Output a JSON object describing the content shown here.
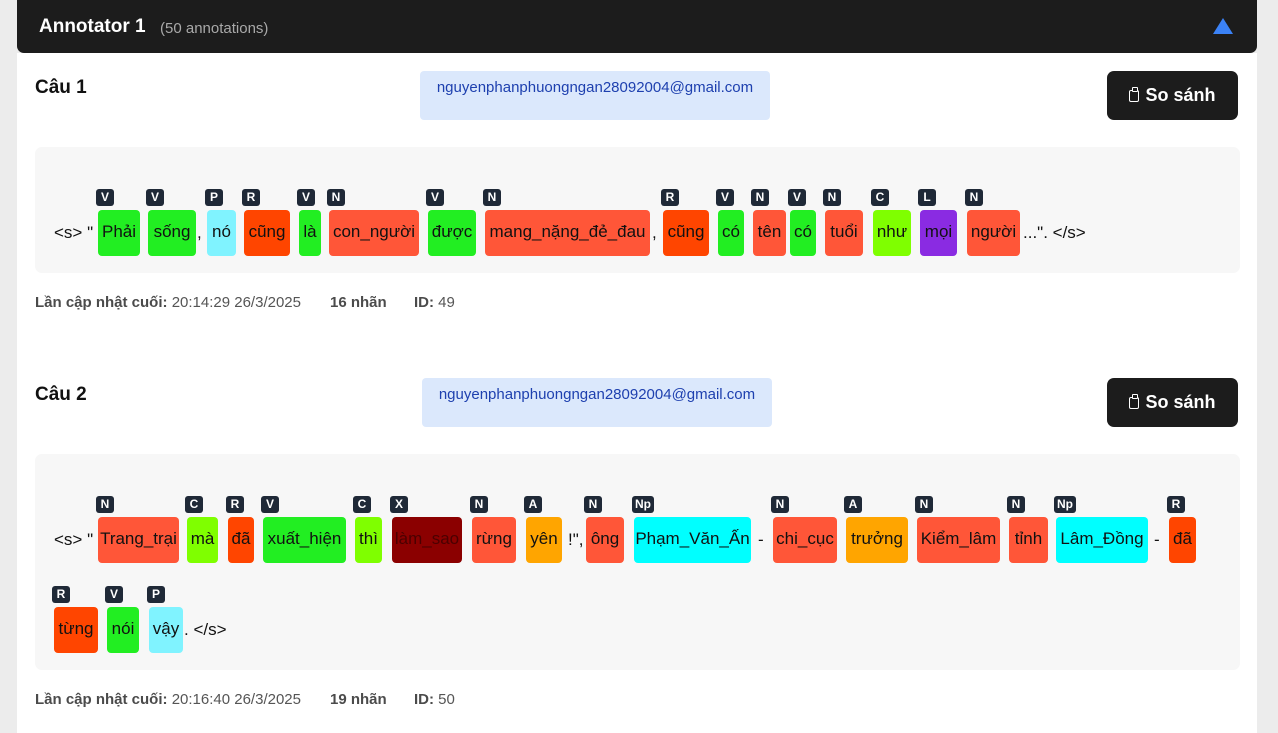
{
  "annotator": {
    "title": "Annotator 1",
    "count_text": "(50 annotations)",
    "collapse_icon": "triangle-up-icon"
  },
  "sentences": [
    {
      "title": "Câu 1",
      "email": "nguyenphanphuongngan28092004@gmail.com",
      "compare_label": "So sánh",
      "updated_label": "Lần cập nhật cuối:",
      "updated_value": "20:14:29 26/3/2025",
      "label_count": "16",
      "label_word": "nhãn",
      "id_label": "ID:",
      "id_value": "49",
      "lines": [
        [
          {
            "t": "text",
            "v": "<s> \""
          },
          {
            "t": "word",
            "w": "Phải",
            "l": "V"
          },
          {
            "t": "word",
            "w": "sống",
            "l": "V"
          },
          {
            "t": "text",
            "v": ","
          },
          {
            "t": "word",
            "w": "nó",
            "l": "P"
          },
          {
            "t": "word",
            "w": "cũng",
            "l": "R"
          },
          {
            "t": "word",
            "w": "là",
            "l": "V"
          },
          {
            "t": "word",
            "w": "con_người",
            "l": "N"
          },
          {
            "t": "word",
            "w": "được",
            "l": "V"
          },
          {
            "t": "word",
            "w": "mang_nặng_đẻ_đau",
            "l": "N"
          },
          {
            "t": "text",
            "v": ","
          },
          {
            "t": "word",
            "w": "cũng",
            "l": "R"
          },
          {
            "t": "word",
            "w": "có",
            "l": "V"
          },
          {
            "t": "word",
            "w": "tên",
            "l": "N"
          },
          {
            "t": "word",
            "w": "có",
            "l": "V"
          },
          {
            "t": "word",
            "w": "tuổi",
            "l": "N"
          },
          {
            "t": "word",
            "w": "như",
            "l": "C"
          },
          {
            "t": "word",
            "w": "mọi",
            "l": "L"
          },
          {
            "t": "word",
            "w": "người",
            "l": "N"
          },
          {
            "t": "text",
            "v": "...\". </s>"
          }
        ]
      ]
    },
    {
      "title": "Câu 2",
      "email": "nguyenphanphuongngan28092004@gmail.com",
      "compare_label": "So sánh",
      "updated_label": "Lần cập nhật cuối:",
      "updated_value": "20:16:40 26/3/2025",
      "label_count": "19",
      "label_word": "nhãn",
      "id_label": "ID:",
      "id_value": "50",
      "lines": [
        [
          {
            "t": "text",
            "v": "<s> \""
          },
          {
            "t": "word",
            "w": "Trang_trại",
            "l": "N"
          },
          {
            "t": "word",
            "w": "mà",
            "l": "C"
          },
          {
            "t": "word",
            "w": "đã",
            "l": "R"
          },
          {
            "t": "word",
            "w": "xuất_hiện",
            "l": "V"
          },
          {
            "t": "word",
            "w": "thì",
            "l": "C"
          },
          {
            "t": "word",
            "w": "làm_sao",
            "l": "X"
          },
          {
            "t": "word",
            "w": "rừng",
            "l": "N"
          },
          {
            "t": "word",
            "w": "yên",
            "l": "A"
          },
          {
            "t": "text",
            "v": "!\","
          },
          {
            "t": "word",
            "w": "ông",
            "l": "N"
          },
          {
            "t": "word",
            "w": "Phạm_Văn_Ấn",
            "l": "Np"
          },
          {
            "t": "text",
            "v": "-"
          },
          {
            "t": "word",
            "w": "chi_cục",
            "l": "N"
          },
          {
            "t": "word",
            "w": "trưởng",
            "l": "A"
          },
          {
            "t": "word",
            "w": "Kiểm_lâm",
            "l": "N"
          },
          {
            "t": "word",
            "w": "tỉnh",
            "l": "N"
          },
          {
            "t": "word",
            "w": "Lâm_Đồng",
            "l": "Np"
          },
          {
            "t": "text",
            "v": "-"
          },
          {
            "t": "word",
            "w": "đã",
            "l": "R"
          }
        ],
        [
          {
            "t": "word",
            "w": "từng",
            "l": "R"
          },
          {
            "t": "word",
            "w": "nói",
            "l": "V"
          },
          {
            "t": "word",
            "w": "vậy",
            "l": "P"
          },
          {
            "t": "text",
            "v": ". </s>"
          }
        ]
      ]
    }
  ]
}
